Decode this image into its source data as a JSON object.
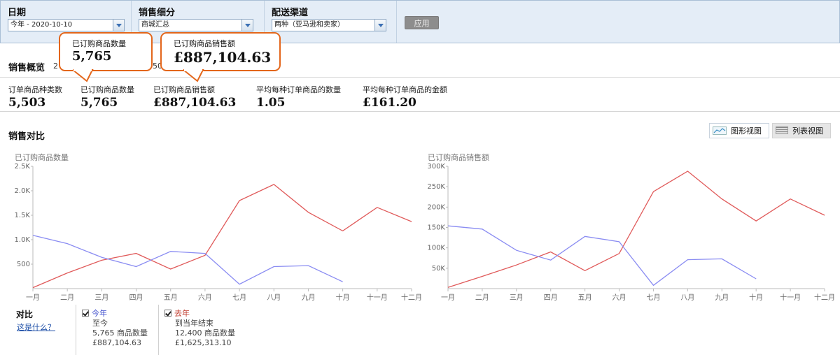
{
  "filters": {
    "date": {
      "label": "日期",
      "value": "今年 - 2020-10-10"
    },
    "breakdown": {
      "label": "销售细分",
      "value": "商城汇总"
    },
    "channel": {
      "label": "配送渠道",
      "value": "两种（亚马逊和卖家）"
    },
    "apply_label": "应用"
  },
  "overview": {
    "title": "销售概览",
    "title_suffix_left": "2",
    "title_suffix_right": "50",
    "stats": [
      {
        "label": "订单商品种类数",
        "value": "5,503"
      },
      {
        "label": "已订购商品数量",
        "value": "5,765"
      },
      {
        "label": "已订购商品销售额",
        "value": "£887,104.63"
      },
      {
        "label": "平均每种订单商品的数量",
        "value": "1.05"
      },
      {
        "label": "平均每种订单商品的金额",
        "value": "£161.20"
      }
    ]
  },
  "callouts": [
    {
      "label": "已订购商品数量",
      "value": "5,765"
    },
    {
      "label": "已订购商品销售额",
      "value": "£887,104.63"
    }
  ],
  "comparison": {
    "title": "销售对比",
    "graph_view_label": "图形视图",
    "list_view_label": "列表视图"
  },
  "colors": {
    "this_year": "#8a8cf2",
    "last_year": "#e05a5a",
    "callout_border": "#e3661b",
    "link": "#1e4fa8"
  },
  "icons": [
    "dropdown-arrow-icon",
    "line-chart-icon",
    "table-icon",
    "checkbox-checked-icon"
  ],
  "chart_data": [
    {
      "type": "line",
      "title": "已订购商品数量",
      "categories": [
        "一月",
        "二月",
        "三月",
        "四月",
        "五月",
        "六月",
        "七月",
        "八月",
        "九月",
        "十月",
        "十一月",
        "十二月"
      ],
      "y_ticks": [
        "500",
        "1.0K",
        "1.5K",
        "2.0K",
        "2.5K"
      ],
      "ylim": [
        0,
        2500
      ],
      "grid": false,
      "series": [
        {
          "name": "今年",
          "values": [
            1090,
            920,
            640,
            450,
            760,
            720,
            90,
            450,
            470,
            140
          ]
        },
        {
          "name": "去年",
          "values": [
            20,
            320,
            580,
            720,
            400,
            680,
            1800,
            2130,
            1560,
            1180,
            1660,
            1370
          ]
        }
      ]
    },
    {
      "type": "line",
      "title": "已订购商品销售额",
      "categories": [
        "一月",
        "二月",
        "三月",
        "四月",
        "五月",
        "六月",
        "七月",
        "八月",
        "九月",
        "十月",
        "十一月",
        "十二月"
      ],
      "y_ticks": [
        "50K",
        "100K",
        "150K",
        "200K",
        "250K",
        "300K"
      ],
      "ylim": [
        0,
        300000
      ],
      "grid": false,
      "series": [
        {
          "name": "今年",
          "values": [
            154000,
            146000,
            94000,
            70000,
            128000,
            115000,
            8000,
            71000,
            73000,
            24000
          ]
        },
        {
          "name": "去年",
          "values": [
            3000,
            30000,
            58000,
            90000,
            44000,
            86000,
            238000,
            288000,
            220000,
            166000,
            220000,
            180000
          ]
        }
      ]
    }
  ],
  "legend": {
    "title": "对比",
    "link": "这是什么？",
    "this_year": {
      "name": "今年",
      "period": "至今",
      "qty": "5,765 商品数量",
      "amount": "£887,104.63"
    },
    "last_year": {
      "name": "去年",
      "period": "到当年结束",
      "qty": "12,400 商品数量",
      "amount": "£1,625,313.10"
    }
  }
}
